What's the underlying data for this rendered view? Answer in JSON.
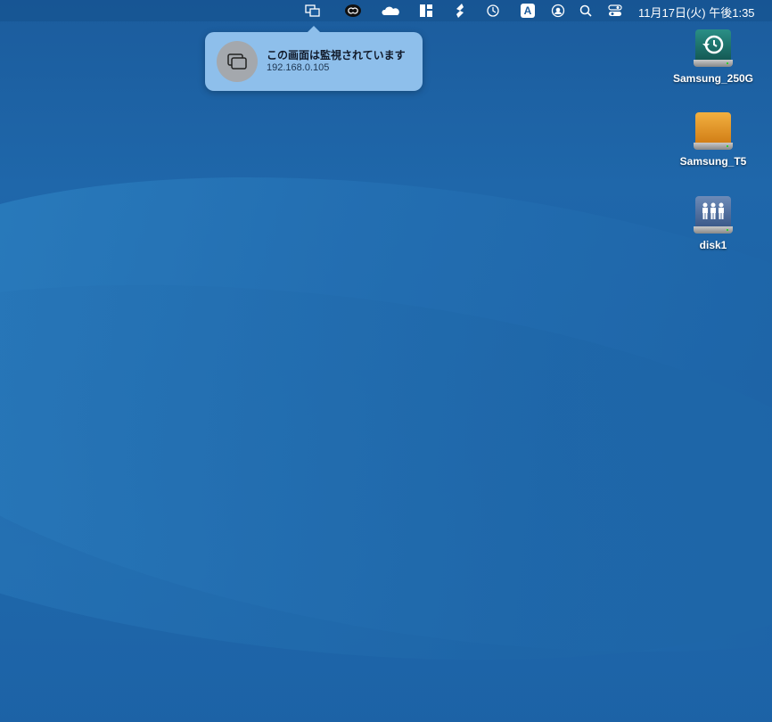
{
  "menubar": {
    "items": [
      {
        "name": "screen-mirroring-icon"
      },
      {
        "name": "creative-cloud-icon"
      },
      {
        "name": "onedrive-icon"
      },
      {
        "name": "layout-icon"
      },
      {
        "name": "script-icon"
      },
      {
        "name": "time-machine-icon"
      },
      {
        "name": "input-source-icon",
        "label": "A"
      },
      {
        "name": "user-icon"
      },
      {
        "name": "search-icon"
      },
      {
        "name": "control-center-icon"
      }
    ],
    "clock": "11月17日(火) 午後1:35"
  },
  "notification": {
    "title": "この画面は監視されています",
    "subtitle": "192.168.0.105"
  },
  "desktop": {
    "drives": [
      {
        "label": "Samsung_250G",
        "color": "#1f7a72"
      },
      {
        "label": "Samsung_T5",
        "color": "#e3952a"
      },
      {
        "label": "disk1",
        "color": "#4e6e9e"
      }
    ]
  }
}
